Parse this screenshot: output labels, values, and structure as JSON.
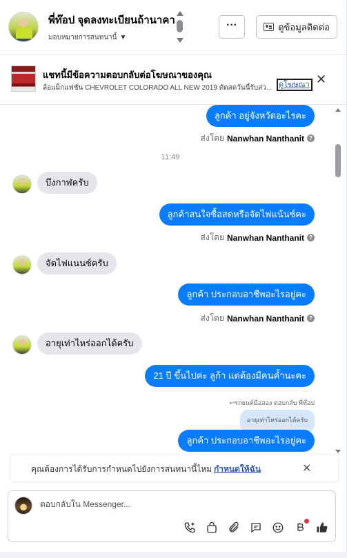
{
  "header": {
    "contact_name": "พี่ท๊อป จุดลงทะเบียนถ้านาคา",
    "contact_subtitle": "มอบหมายการสนทนานี้",
    "more_label": "···",
    "info_button_label": "ดูข้อมูลติดต่อ"
  },
  "ad_banner": {
    "title": "แชทนี้มีข้อความตอบกลับต่อโฆษณาของคุณ",
    "text": "ล้อแม็กแฟชั่น CHEVROLET COLORADO ALL NEW 2019 ตัดสดวันนี้รับส่ว...",
    "link_label": "ดูโฆษณา",
    "close_label": "✕"
  },
  "messages": [
    {
      "kind": "out",
      "text": "ลูกค้า อยู่จังหวัดอะไรคะ"
    },
    {
      "kind": "sentby",
      "prefix": "ส่งโดย",
      "name": "Nanwhan Nanthanit"
    },
    {
      "kind": "timestamp",
      "text": "11:49"
    },
    {
      "kind": "in",
      "text": "บึงกาฬครับ"
    },
    {
      "kind": "out",
      "text": "ลูกค้าสนใจซื้อสดหรือจัดไฟแน้นซ์คะ"
    },
    {
      "kind": "sentby",
      "prefix": "ส่งโดย",
      "name": "Nanwhan Nanthanit"
    },
    {
      "kind": "in",
      "text": "จัดไฟแนนซ์ครับ"
    },
    {
      "kind": "out",
      "text": "ลูกค้า ประกอบอาชีพอะไรอยู่คะ"
    },
    {
      "kind": "sentby",
      "prefix": "ส่งโดย",
      "name": "Nanwhan Nanthanit"
    },
    {
      "kind": "in",
      "text": "อายุเท่าไหร่ออกได้ครับ"
    },
    {
      "kind": "out",
      "text": "21 ปี ขึ้นไปค่ะ ลูก้า แต่ต้องมีคนค้ำนะคะ"
    },
    {
      "kind": "reply_label",
      "text": "↩รถยนต์มือสอง ตอบกลับ พี่ท๊อป"
    },
    {
      "kind": "quoted",
      "text": "อายุเท่าไหร่ออกได้ครับ"
    },
    {
      "kind": "out",
      "text": "ลูกค้า ประกอบอาชีพอะไรอยู่คะ"
    }
  ],
  "notice": {
    "text": "คุณต้องการได้รับการกำหนดไปยังการสนทนานี้ไหม",
    "link_label": "กำหนดให้ฉัน",
    "close_label": "✕"
  },
  "composer": {
    "placeholder": "ตอบกลับใน Messenger..."
  },
  "colors": {
    "outgoing_bubble": "#0a7cff",
    "incoming_bubble": "#e4e6eb",
    "link": "#2a57b6",
    "notification_dot": "#e4334f"
  },
  "icons": [
    "phone-add-icon",
    "shopping-bag-icon",
    "paperclip-icon",
    "chat-bubble-icon",
    "emoji-icon",
    "baht-icon",
    "thumbs-up-icon"
  ]
}
